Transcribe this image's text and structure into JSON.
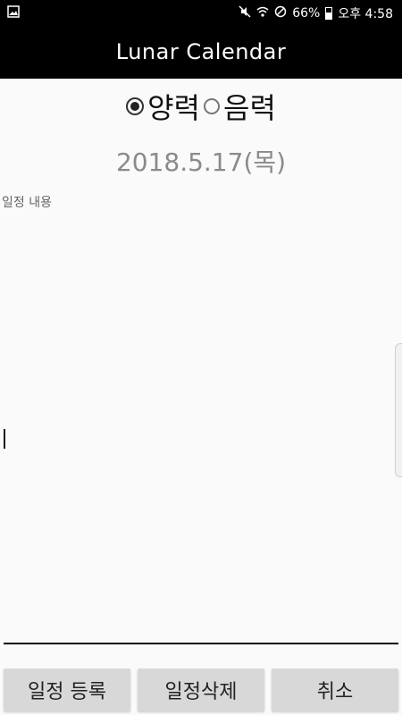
{
  "status_bar": {
    "left_icon": "image-notification-icon",
    "icons": [
      "mute-icon",
      "wifi-icon",
      "do-not-disturb-icon",
      "battery-icon"
    ],
    "battery_text": "66%",
    "time": "오후 4:58"
  },
  "app_bar": {
    "title": "Lunar Calendar"
  },
  "calendar_type": {
    "options": [
      {
        "label": "양력",
        "selected": true
      },
      {
        "label": "음력",
        "selected": false
      }
    ]
  },
  "date_display": "2018.5.17(목)",
  "memo": {
    "label": "일정 내용",
    "value": ""
  },
  "buttons": {
    "register": "일정 등록",
    "delete": "일정삭제",
    "cancel": "취소"
  }
}
